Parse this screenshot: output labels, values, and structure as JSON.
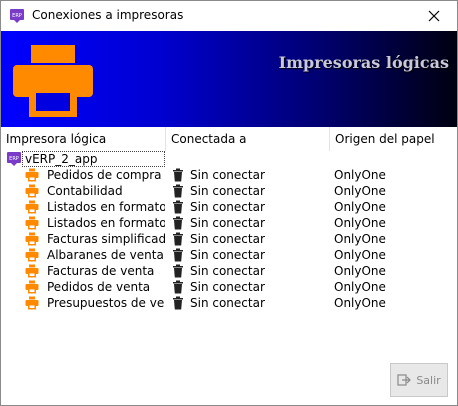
{
  "window": {
    "title": "Conexiones a impresoras",
    "icon": "erp-app-icon",
    "close_icon": "close-icon"
  },
  "banner": {
    "title": "Impresoras lógicas",
    "icon": "printer-icon",
    "accent": "#ff8a00"
  },
  "columns": [
    "Impresora lógica",
    "Conectada a",
    "Origen del papel"
  ],
  "root": {
    "label": "vERP_2_app",
    "icon": "erp-app-icon"
  },
  "rows": [
    {
      "name": "Pedidos de compra",
      "connected": "Sin conectar",
      "source": "OnlyOne"
    },
    {
      "name": "Contabilidad",
      "connected": "Sin conectar",
      "source": "OnlyOne"
    },
    {
      "name": "Listados en formato...",
      "connected": "Sin conectar",
      "source": "OnlyOne"
    },
    {
      "name": "Listados en formato...",
      "connected": "Sin conectar",
      "source": "OnlyOne"
    },
    {
      "name": "Facturas simplificadas",
      "connected": "Sin conectar",
      "source": "OnlyOne"
    },
    {
      "name": "Albaranes de venta",
      "connected": "Sin conectar",
      "source": "OnlyOne"
    },
    {
      "name": "Facturas de venta",
      "connected": "Sin conectar",
      "source": "OnlyOne"
    },
    {
      "name": "Pedidos de venta",
      "connected": "Sin conectar",
      "source": "OnlyOne"
    },
    {
      "name": "Presupuestos de ve...",
      "connected": "Sin conectar",
      "source": "OnlyOne"
    }
  ],
  "row_icons": {
    "printer": "printer-icon",
    "connection": "trash-icon"
  },
  "footer": {
    "exit_label": "Salir",
    "exit_icon": "exit-icon"
  }
}
